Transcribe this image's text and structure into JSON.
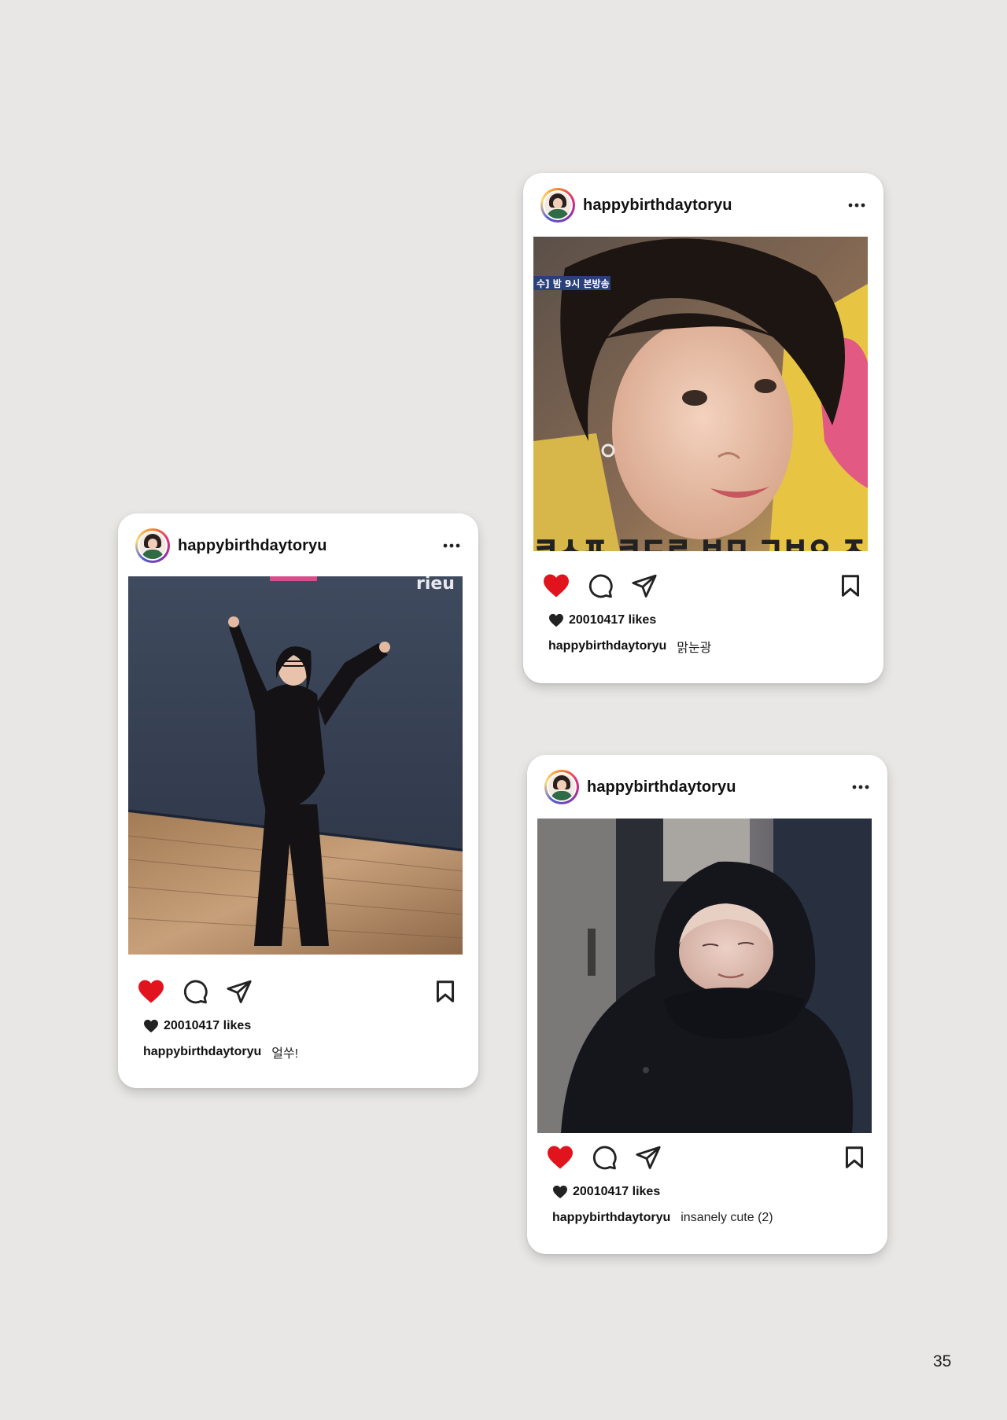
{
  "page": {
    "number": "35"
  },
  "colors": {
    "background": "#e8e7e5",
    "like_red": "#e1141e",
    "text": "#111111"
  },
  "posts": [
    {
      "username": "happybirthdaytoryu",
      "more_icon": "more-horizontal-icon",
      "image_overlay": "수] 밤 9시 본방송",
      "image_subtitle": "ㅋㅅㅍ ㅋㄷㄹ ㅂㅁ ㄱㅂㅇ ㅈㄱ",
      "likes": "20010417 likes",
      "caption_user": "happybirthdaytoryu",
      "caption_text": "맑눈광",
      "liked": true
    },
    {
      "username": "happybirthdaytoryu",
      "more_icon": "more-horizontal-icon",
      "image_sign": "rieu",
      "likes": "20010417 likes",
      "caption_user": "happybirthdaytoryu",
      "caption_text": "얼쑤!",
      "liked": true
    },
    {
      "username": "happybirthdaytoryu",
      "more_icon": "more-horizontal-icon",
      "likes": "20010417 likes",
      "caption_user": "happybirthdaytoryu",
      "caption_text": "insanely cute (2)",
      "liked": true
    }
  ]
}
